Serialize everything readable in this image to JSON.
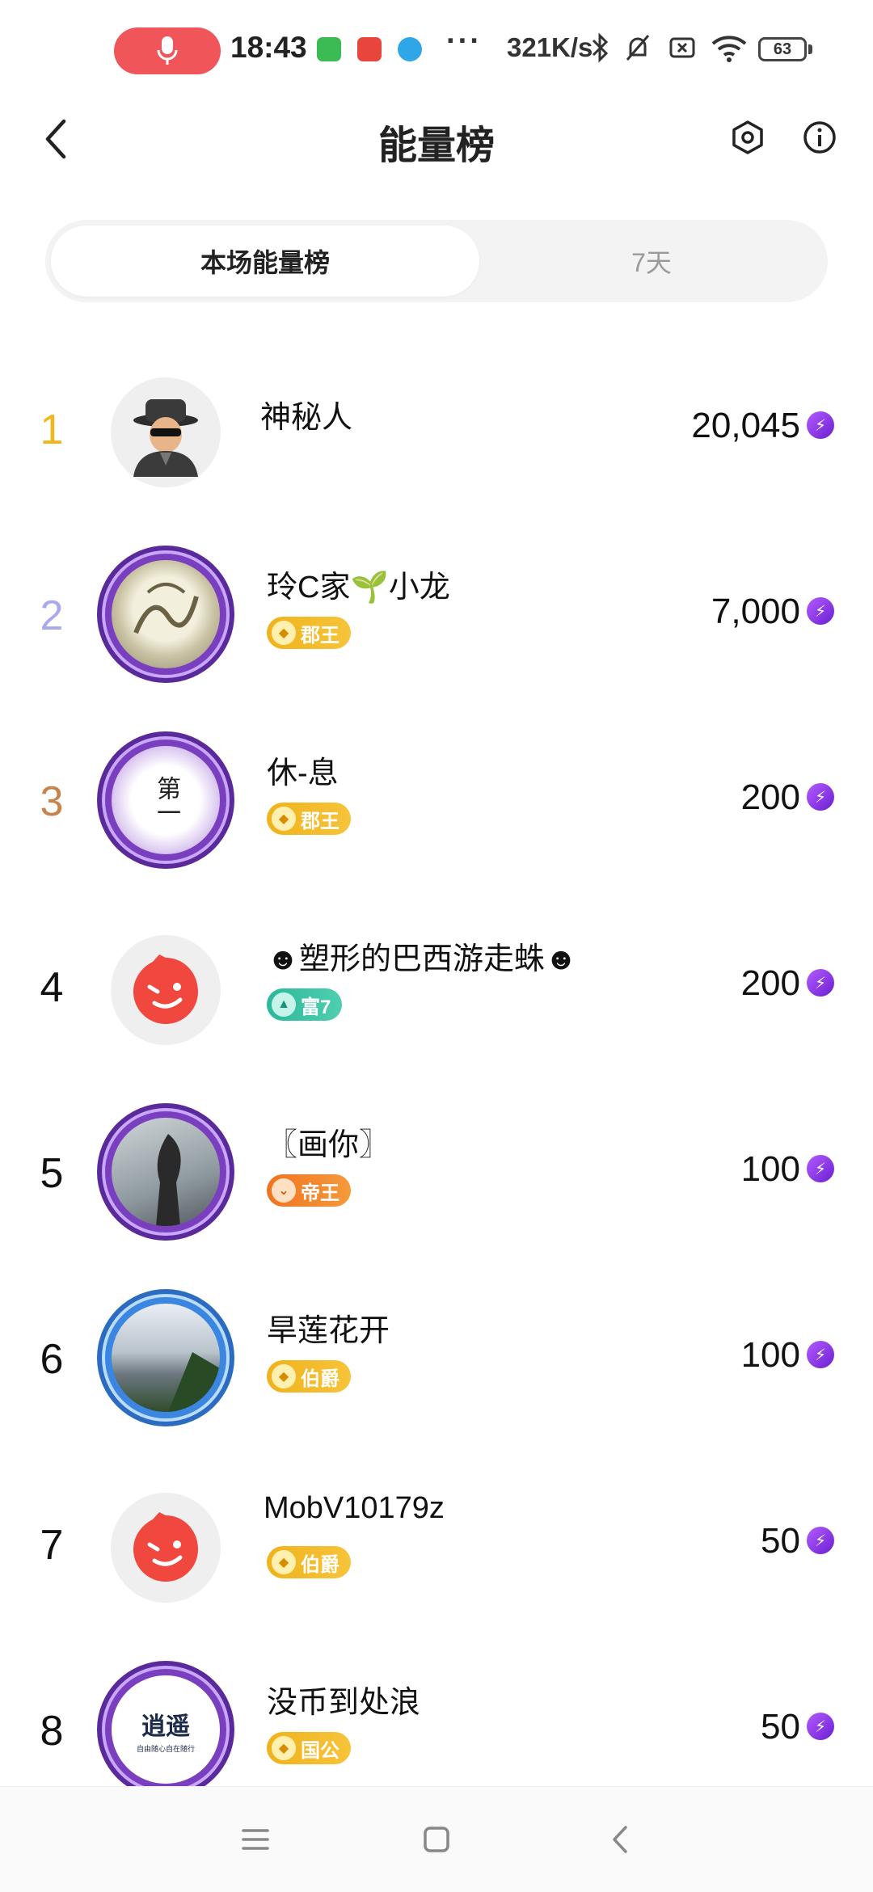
{
  "status_bar": {
    "time": "18:43",
    "net_speed": "321K/s",
    "dots": "···",
    "battery": "63"
  },
  "header": {
    "title": "能量榜"
  },
  "tabs": [
    {
      "label": "本场能量榜",
      "active": true
    },
    {
      "label": "7天",
      "active": false
    }
  ],
  "ranking": [
    {
      "rank": "1",
      "name": "神秘人",
      "score": "20,045",
      "badge": "",
      "rank_color": "#f2b51c"
    },
    {
      "rank": "2",
      "name": "玲C家🌱小龙",
      "score": "7,000",
      "badge": "郡王",
      "rank_color": "#a9a9ee"
    },
    {
      "rank": "3",
      "name": "休-息",
      "score": "200",
      "badge": "郡王",
      "rank_color": "#c8824a"
    },
    {
      "rank": "4",
      "name": "☻塑形的巴西游走蛛☻",
      "score": "200",
      "badge": "富7",
      "rank_color": "#111111"
    },
    {
      "rank": "5",
      "name": "〖画你〗",
      "score": "100",
      "badge": "帝王",
      "rank_color": "#111111"
    },
    {
      "rank": "6",
      "name": "旱莲花开",
      "score": "100",
      "badge": "伯爵",
      "rank_color": "#111111"
    },
    {
      "rank": "7",
      "name": "MobV10179z",
      "score": "50",
      "badge": "伯爵",
      "rank_color": "#111111"
    },
    {
      "rank": "8",
      "name": "没币到处浪",
      "score": "50",
      "badge": "国公",
      "rank_color": "#111111"
    }
  ],
  "avatar_text": {
    "row3": "第一",
    "row8_main": "逍遥",
    "row8_sub": "自由随心自在随行"
  }
}
